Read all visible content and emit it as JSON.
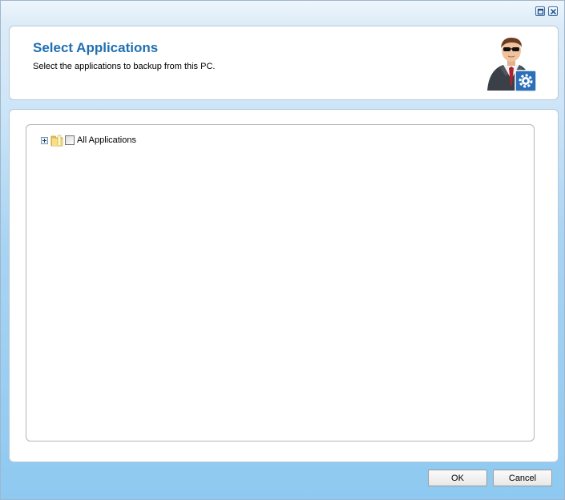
{
  "window": {
    "controls": [
      {
        "name": "maximize",
        "icon": "maximize-icon"
      },
      {
        "name": "close",
        "icon": "close-icon"
      }
    ]
  },
  "header": {
    "title": "Select Applications",
    "subtitle": "Select the applications to backup from this PC.",
    "avatar_icon": "user-settings-icon"
  },
  "tree": {
    "nodes": [
      {
        "label": "All Applications",
        "expanded": false,
        "checked": false,
        "icon": "folder-icon"
      }
    ]
  },
  "buttons": {
    "ok": "OK",
    "cancel": "Cancel"
  },
  "colors": {
    "title": "#1f6fb3",
    "background_bottom": "#8ec9f1",
    "panel_border": "#b9c9d8"
  }
}
